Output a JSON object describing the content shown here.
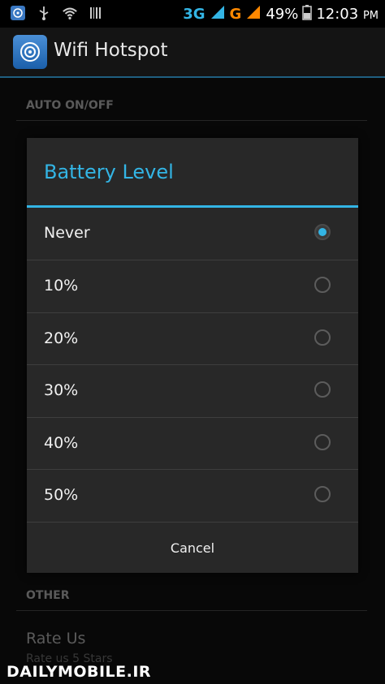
{
  "status_bar": {
    "network_3g": "3G",
    "network_g": "G",
    "battery_percent": "49%",
    "time": "12:03",
    "ampm": "PM"
  },
  "app": {
    "title": "Wifi Hotspot"
  },
  "background": {
    "section_auto": "AUTO ON/OFF",
    "section_other": "OTHER",
    "rate_title": "Rate Us",
    "rate_subtitle": "Rate us 5 Stars"
  },
  "dialog": {
    "title": "Battery Level",
    "options": [
      {
        "label": "Never",
        "selected": true
      },
      {
        "label": "10%",
        "selected": false
      },
      {
        "label": "20%",
        "selected": false
      },
      {
        "label": "30%",
        "selected": false
      },
      {
        "label": "40%",
        "selected": false
      },
      {
        "label": "50%",
        "selected": false
      }
    ],
    "cancel_label": "Cancel"
  },
  "watermark": "DAILYMOBILE.IR",
  "colors": {
    "accent": "#33b5e5",
    "background": "#000000",
    "dialog_bg": "#282828"
  }
}
